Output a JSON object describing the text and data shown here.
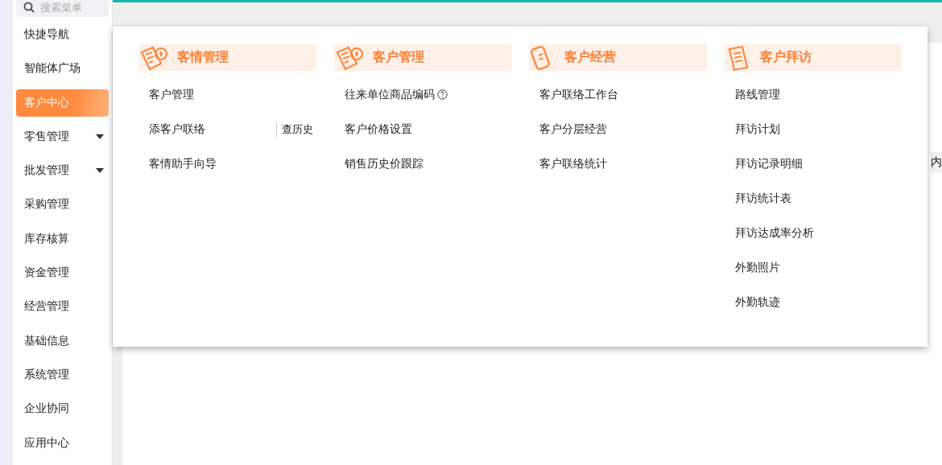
{
  "sidebar": {
    "search": {
      "placeholder": "搜索菜单"
    },
    "items": [
      {
        "label": "快捷导航",
        "selected": false,
        "expandable": false
      },
      {
        "label": "智能体广场",
        "selected": false,
        "expandable": false
      },
      {
        "label": "客户中心",
        "selected": true,
        "expandable": false
      },
      {
        "label": "零售管理",
        "selected": false,
        "expandable": true
      },
      {
        "label": "批发管理",
        "selected": false,
        "expandable": true
      },
      {
        "label": "采购管理",
        "selected": false,
        "expandable": false
      },
      {
        "label": "库存核算",
        "selected": false,
        "expandable": false
      },
      {
        "label": "资金管理",
        "selected": false,
        "expandable": false
      },
      {
        "label": "经营管理",
        "selected": false,
        "expandable": false
      },
      {
        "label": "基础信息",
        "selected": false,
        "expandable": false
      },
      {
        "label": "系统管理",
        "selected": false,
        "expandable": false
      },
      {
        "label": "企业协同",
        "selected": false,
        "expandable": false
      },
      {
        "label": "应用中心",
        "selected": false,
        "expandable": false
      }
    ]
  },
  "page": {
    "column_header": "内"
  },
  "menu": {
    "groups": [
      {
        "title": "客情管理",
        "kind": "form",
        "items": [
          {
            "label": "客户管理"
          },
          {
            "label": "添客户联络",
            "action": "查历史"
          },
          {
            "label": "客情助手向导"
          }
        ]
      },
      {
        "title": "客户管理",
        "kind": "form",
        "items": [
          {
            "label": "往来单位商品编码",
            "help": true
          },
          {
            "label": "客户价格设置"
          },
          {
            "label": "销售历史价跟踪"
          }
        ]
      },
      {
        "title": "客户经营",
        "kind": "phone",
        "items": [
          {
            "label": "客户联络工作台"
          },
          {
            "label": "客户分层经营"
          },
          {
            "label": "客户联络统计"
          }
        ]
      },
      {
        "title": "客户拜访",
        "kind": "clipboard",
        "items": [
          {
            "label": "路线管理"
          },
          {
            "label": "拜访计划"
          },
          {
            "label": "拜访记录明细"
          },
          {
            "label": "拜访统计表"
          },
          {
            "label": "拜访达成率分析"
          },
          {
            "label": "外勤照片"
          },
          {
            "label": "外勤轨迹"
          }
        ]
      }
    ]
  }
}
